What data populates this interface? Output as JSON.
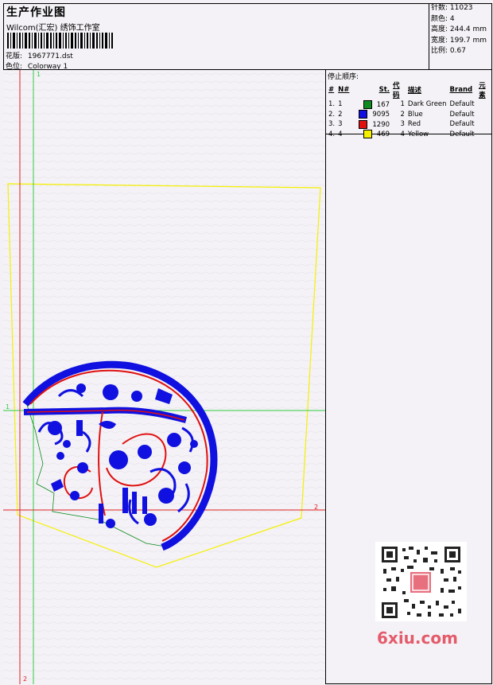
{
  "header": {
    "title": "生产作业图",
    "company": "Wilcom(汇宏) 绣饰工作室",
    "design_file_label": "花版:",
    "design_file": "1967771.dst",
    "colorway_label": "色位:",
    "colorway": "Colorway 1"
  },
  "stats": {
    "stitches": "针数: 11023",
    "colors": "颜色: 4",
    "height": "高度: 244.4 mm",
    "width": "宽度: 199.7 mm",
    "scale": "比例: 0.67"
  },
  "stop_sequence": {
    "title": "停止顺序:",
    "headers": [
      "#",
      "N#",
      "St.",
      "代码",
      "描述",
      "Brand",
      "元素"
    ],
    "rows": [
      {
        "num": "1.",
        "n": "1",
        "color": "#0f8a1e",
        "st": "167",
        "code": "1",
        "desc": "Dark Green",
        "brand": "Default"
      },
      {
        "num": "2.",
        "n": "2",
        "color": "#1010e0",
        "st": "9095",
        "code": "2",
        "desc": "Blue",
        "brand": "Default"
      },
      {
        "num": "3.",
        "n": "3",
        "color": "#e01010",
        "st": "1290",
        "code": "3",
        "desc": "Red",
        "brand": "Default"
      },
      {
        "num": "4.",
        "n": "4",
        "color": "#f5f000",
        "st": "469",
        "code": "4",
        "desc": "Yellow",
        "brand": "Default"
      }
    ]
  },
  "guides": {
    "green_top": "1",
    "green_left": "1",
    "red_right": "2",
    "red_bottom": "2"
  },
  "watermark": {
    "logo": "6xiu.com"
  },
  "colors": {
    "blue": "#1010e0",
    "red": "#e01010",
    "green": "#0f8a1e",
    "yellow": "#f5f000",
    "guide_green": "#2ecc40",
    "guide_red": "#e02020"
  }
}
